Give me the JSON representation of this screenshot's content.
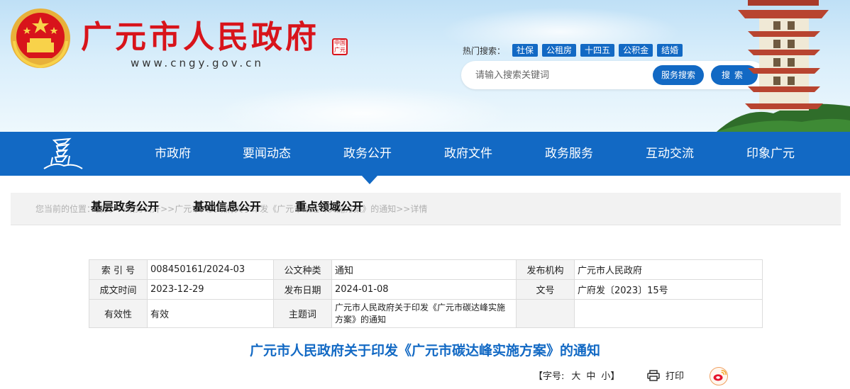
{
  "header": {
    "site_title": "广元市人民政府",
    "site_url": "www.cngy.gov.cn",
    "seal_text": "中国广元",
    "hot_search_label": "热门搜索：",
    "hot_tags": [
      "社保",
      "公租房",
      "十四五",
      "公积金",
      "结婚"
    ],
    "search_placeholder": "请输入搜索关键词",
    "service_search_label": "服务搜索",
    "search_label": "搜索"
  },
  "nav": {
    "items": [
      "市政府",
      "要闻动态",
      "政务公开",
      "政府文件",
      "政务服务",
      "互动交流",
      "印象广元"
    ],
    "active_index": 2
  },
  "subnav": {
    "items": [
      "基层政务公开",
      "基础信息公开",
      "重点领域公开"
    ]
  },
  "breadcrumb": "您当前的位置：首页>>政务公开>>广元市人民政府关于印发《广元市碳达峰实施方案》的通知>>详情",
  "info": {
    "index_label": "索 引 号",
    "index_value": "008450161/2024-03",
    "category_label": "公文种类",
    "category_value": "通知",
    "issuer_label": "发布机构",
    "issuer_value": "广元市人民政府",
    "created_label": "成文时间",
    "created_value": "2023-12-29",
    "published_label": "发布日期",
    "published_value": "2024-01-08",
    "docno_label": "文号",
    "docno_value": "广府发〔2023〕15号",
    "validity_label": "有效性",
    "validity_value": "有效",
    "subject_label": "主题词",
    "subject_value": "广元市人民政府关于印发《广元市碳达峰实施方案》的通知"
  },
  "doc_title": "广元市人民政府关于印发《广元市碳达峰实施方案》的通知",
  "tools": {
    "font_size_label": "【字号:",
    "large": "大",
    "medium": "中",
    "small": "小】",
    "print_label": "打印"
  },
  "colors": {
    "brand_blue": "#1269c4",
    "title_red": "#d8141b"
  }
}
